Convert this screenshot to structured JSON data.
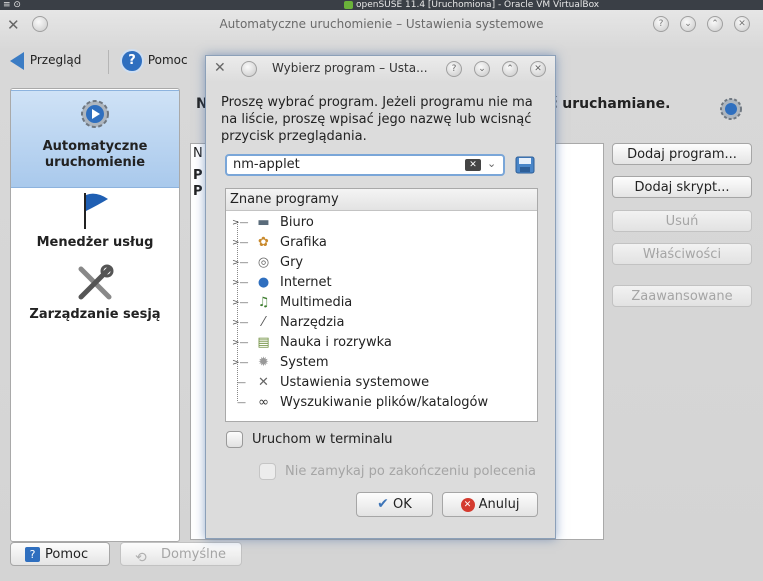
{
  "vbox": {
    "title": "openSUSE 11.4 [Uruchomiona] - Oracle VM VirtualBox"
  },
  "window": {
    "title": "Automatyczne uruchomienie – Ustawienia systemowe"
  },
  "toolbar": {
    "overview_label": "Przegląd",
    "help_label": "Pomoc"
  },
  "sidebar": {
    "items": [
      {
        "label": "Automatyczne uruchomienie",
        "selected": true
      },
      {
        "label": "Menedżer usług",
        "selected": false
      },
      {
        "label": "Zarządzanie sesją",
        "selected": false
      }
    ]
  },
  "main": {
    "heading_left": "N",
    "heading_right": "yć uruchamiane.",
    "list_header_letter": "N",
    "list_rows": [
      "P",
      "P"
    ],
    "buttons": {
      "add_program": "Dodaj program...",
      "add_script": "Dodaj skrypt...",
      "remove": "Usuń",
      "properties": "Właściwości",
      "advanced": "Zaawansowane"
    }
  },
  "footer": {
    "help": "Pomoc",
    "defaults": "Domyślne"
  },
  "dialog": {
    "title": "Wybierz program – Usta...",
    "prompt": "Proszę wybrać program. Jeżeli programu nie ma na liście, proszę wpisać jego nazwę lub wcisnąć przycisk przeglądania.",
    "input_value": "nm-applet",
    "tree_header": "Znane programy",
    "categories": [
      {
        "label": "Biuro",
        "icon": "office-icon",
        "expandable": true
      },
      {
        "label": "Grafika",
        "icon": "graphics-icon",
        "expandable": true
      },
      {
        "label": "Gry",
        "icon": "games-icon",
        "expandable": true
      },
      {
        "label": "Internet",
        "icon": "internet-icon",
        "expandable": true
      },
      {
        "label": "Multimedia",
        "icon": "multimedia-icon",
        "expandable": true
      },
      {
        "label": "Narzędzia",
        "icon": "tools-icon",
        "expandable": true
      },
      {
        "label": "Nauka i rozrywka",
        "icon": "education-icon",
        "expandable": true
      },
      {
        "label": "System",
        "icon": "system-icon",
        "expandable": true
      },
      {
        "label": "Ustawienia systemowe",
        "icon": "settings-icon",
        "expandable": false
      },
      {
        "label": "Wyszukiwanie plików/katalogów",
        "icon": "binoculars-icon",
        "expandable": false
      }
    ],
    "run_in_terminal": "Uruchom w terminalu",
    "do_not_close": "Nie zamykaj po zakończeniu polecenia",
    "ok": "OK",
    "cancel": "Anuluj"
  }
}
